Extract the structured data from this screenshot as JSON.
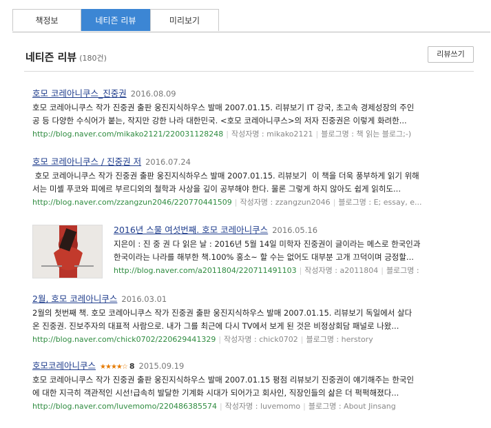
{
  "tabs": [
    "책정보",
    "네티즌 리뷰",
    "미리보기"
  ],
  "header": {
    "title": "네티즌 리뷰",
    "count": "(180건)",
    "write_button": "리뷰쓰기"
  },
  "labels": {
    "author": "작성자명 : ",
    "blog": "블로그명 : "
  },
  "reviews": [
    {
      "title": "호모 코레아니쿠스_진중권",
      "date": "2016.08.09",
      "line1": "호모 코레아니쿠스 작가 진중권 출판 웅진지식하우스 발매 2007.01.15. 리뷰보기 IT 강국, 초고속 경제성장의 주인",
      "line2": "공 등 다양한 수식어가 붙는, 작지만 강한 나라 대한민국. <호모 코레아니쿠스>의 저자 진중권은 이렇게 화려한...",
      "url": "http://blog.naver.com/mikako2121/220031128248",
      "author": "mikako2121",
      "blog": "책 읽는 블로그;-)"
    },
    {
      "title": "호모 코레아니쿠스 / 진중권 저",
      "date": "2016.07.24",
      "line1": " 호모 코레아니쿠스 작가 진중권 출판 웅진지식하우스 발매 2007.01.15. 리뷰보기  이 책을 더욱 풍부하게 읽기 위해",
      "line2": "서는 미셸 푸코와 피에르 부르디외의 철학과 사상을 깊이 공부해야 한다. 물론 그렇게 하지 않아도 쉽게 읽히도...",
      "url": "http://blog.naver.com/zzangzun2046/220770441509",
      "author": "zzangzun2046",
      "blog": "E; essay, e..."
    },
    {
      "title": "2016년 스물 여섯번째. 호모 코레아니쿠스",
      "date": "2016.05.16",
      "line1": "지은이 : 진 중 권 다 읽은 날 : 2016년 5월 14일 미학자 진중권이 글이라는 메스로 한국인과",
      "line2": "한국이라는 나라를 해부한 책.100% 홍소~ 할 수는 없어도 대부분 고개 끄덕이며 긍정할...",
      "url": "http://blog.naver.com/a2011804/220711491103",
      "author": "a2011804",
      "blog": ""
    },
    {
      "title": "2월, 호모 코레아니쿠스",
      "date": "2016.03.01",
      "line1": "2월의 첫번째 책. 호모 코레아니쿠스 작가 진중권 출판 웅진지식하우스 발매 2007.01.15. 리뷰보기  독일에서 살다",
      "line2": "온 진중권. 진보주자의 대표적 사람으로. 내가 그를 최근에 다시 TV에서 보게 된 것은 비정상회담 패널로 나왔...",
      "url": "http://blog.naver.com/chick0702/220629441329",
      "author": "chick0702",
      "blog": "herstory"
    },
    {
      "title": "호모코레아니쿠스",
      "stars": "★★★★☆",
      "score": "8",
      "date": "2015.09.19",
      "line1": "호모 코레아니쿠스 작가 진중권 출판 웅진지식하우스 발매 2007.01.15 평점 리뷰보기 진중권이 얘기해주는 한국인",
      "line2": "에 대한 지극히 객관적인 시선!급속히 발달한 기계화 시대가 되어가고 회사인, 직장인들의 삶은 더 퍽퍽해졌다...",
      "url": "http://blog.naver.com/luvemomo/220486385574",
      "author": "luvemomo",
      "blog": "About Jinsang"
    }
  ]
}
